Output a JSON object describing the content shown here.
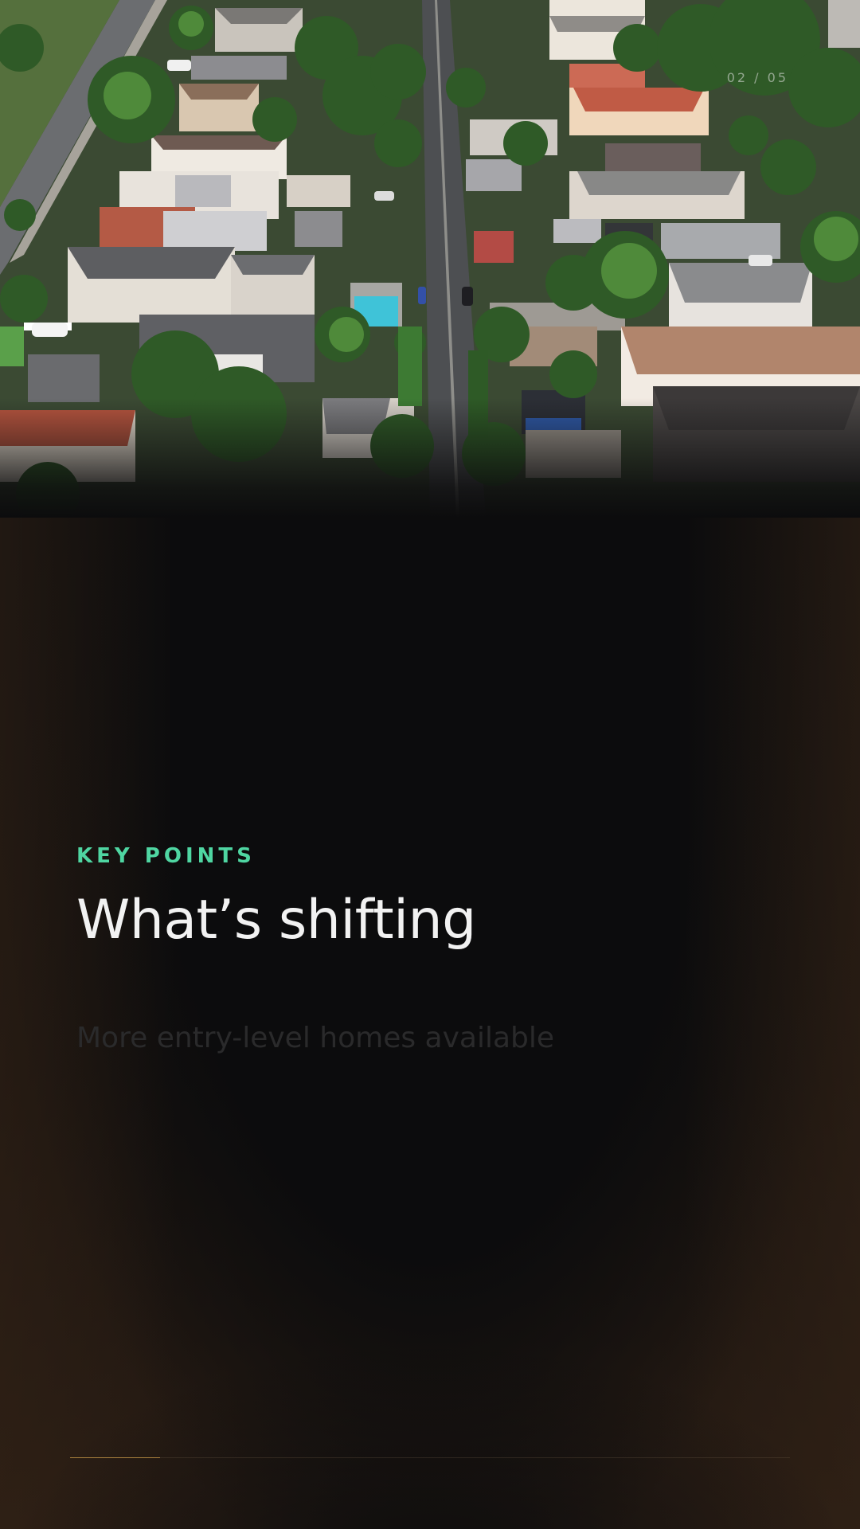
{
  "slide": {
    "counter": "02 / 05",
    "progress": 0.125,
    "hero_image": "aerial-neighborhood-photo"
  },
  "content": {
    "eyebrow": "KEY POINTS",
    "title": "What’s shifting",
    "points": [
      "More entry-level homes available"
    ]
  },
  "colors": {
    "accent": "#4fd6a2",
    "progress": "#a9813e",
    "background": "#0c0c0d",
    "title": "#f2f2f2"
  }
}
